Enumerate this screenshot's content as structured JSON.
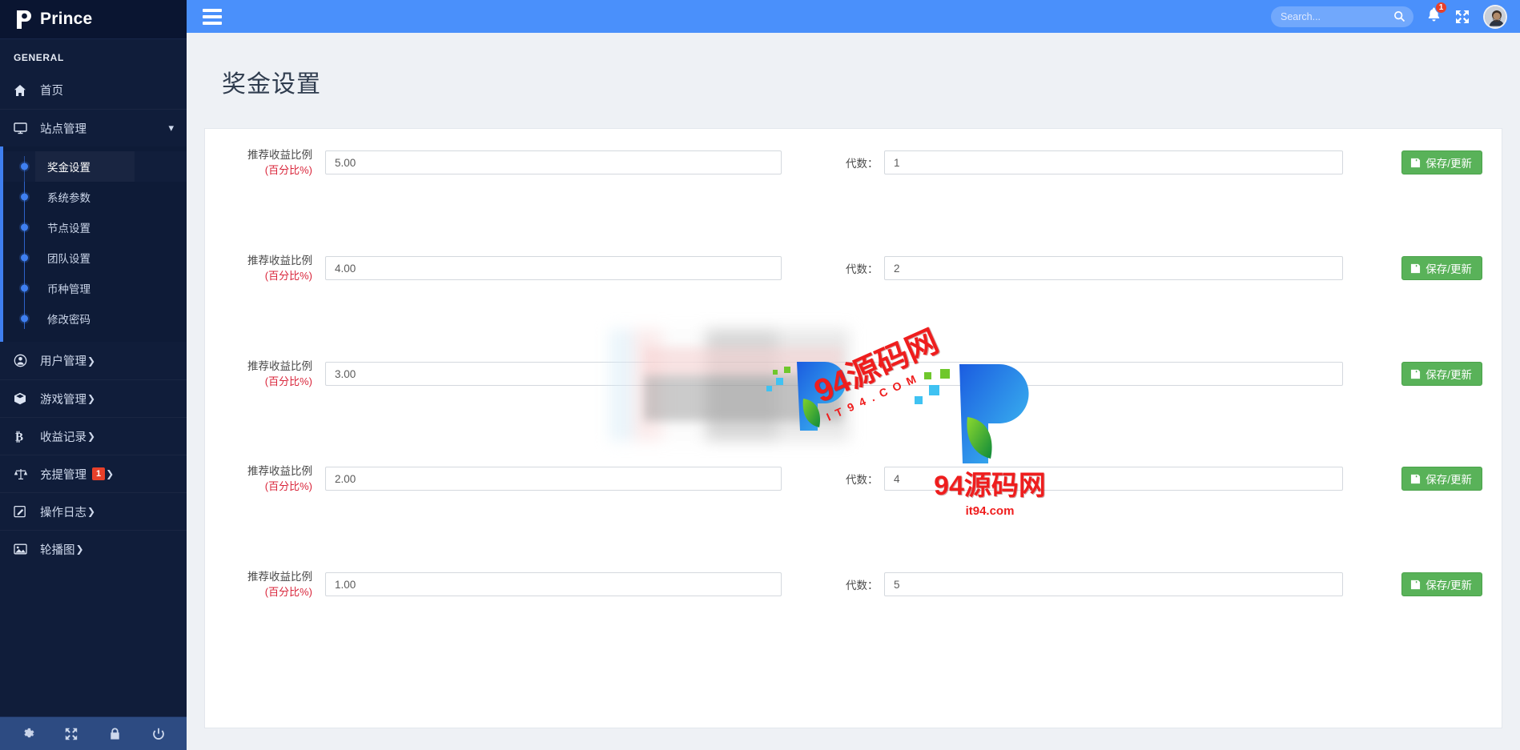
{
  "brand": {
    "name": "Prince",
    "logo_icon": "prince-p-logo"
  },
  "sidebar": {
    "section_label": "GENERAL",
    "items": [
      {
        "label": "首页",
        "icon": "home-icon",
        "has_caret": false
      },
      {
        "label": "站点管理",
        "icon": "monitor-icon",
        "has_caret": false,
        "expanded": true
      }
    ],
    "submenu": [
      {
        "label": "奖金设置",
        "active": true
      },
      {
        "label": "系统参数",
        "active": false
      },
      {
        "label": "节点设置",
        "active": false
      },
      {
        "label": "团队设置",
        "active": false
      },
      {
        "label": "币种管理",
        "active": false
      },
      {
        "label": "修改密码",
        "active": false
      }
    ],
    "items_after": [
      {
        "label": "用户管理",
        "icon": "user-circle-icon",
        "caret": "❯",
        "badge": null
      },
      {
        "label": "游戏管理",
        "icon": "cube-icon",
        "caret": "❯",
        "badge": null
      },
      {
        "label": "收益记录",
        "icon": "bitcoin-icon",
        "caret": "❯",
        "badge": null
      },
      {
        "label": "充提管理",
        "icon": "scales-icon",
        "caret": "❯",
        "badge": "1"
      },
      {
        "label": "操作日志",
        "icon": "edit-square-icon",
        "caret": "❯",
        "badge": null
      },
      {
        "label": "轮播图",
        "icon": "image-icon",
        "caret": "❯",
        "badge": null
      }
    ],
    "footer_icons": [
      {
        "name": "gear-icon"
      },
      {
        "name": "fullscreen-icon"
      },
      {
        "name": "lock-icon"
      },
      {
        "name": "power-icon"
      }
    ]
  },
  "topbar": {
    "menu_toggle_icon": "hamburger-icon",
    "search": {
      "placeholder": "Search...",
      "value": "",
      "icon": "search-icon"
    },
    "notification": {
      "icon": "bell-icon",
      "badge": "1"
    },
    "fullscreen_icon": "expand-arrows-icon",
    "avatar_icon": "user-avatar"
  },
  "page": {
    "title": "奖金设置"
  },
  "form": {
    "percent_label_main": "推荐收益比例",
    "percent_label_sub": "(百分比%)",
    "generation_label": "代数：",
    "save_button": "保存/更新",
    "save_icon": "floppy-save-icon",
    "rows": [
      {
        "percent": "5.00",
        "generation": "1",
        "wide": false
      },
      {
        "percent": "4.00",
        "generation": "2",
        "wide": false
      },
      {
        "percent": "3.00",
        "generation": "",
        "wide": true
      },
      {
        "percent": "2.00",
        "generation": "4",
        "wide": false
      },
      {
        "percent": "1.00",
        "generation": "5",
        "wide": false
      }
    ]
  },
  "watermark": {
    "title": "94源码网",
    "dotted": "IT94.COM",
    "domain": "it94.com",
    "color": "#ef1d1d"
  },
  "colors": {
    "topbar": "#4a90fb",
    "sidebar": "#101d3a",
    "accent": "#3f7ff0",
    "save_button": "#59b259",
    "badge": "#e8402a",
    "label_red": "#d9253a"
  }
}
